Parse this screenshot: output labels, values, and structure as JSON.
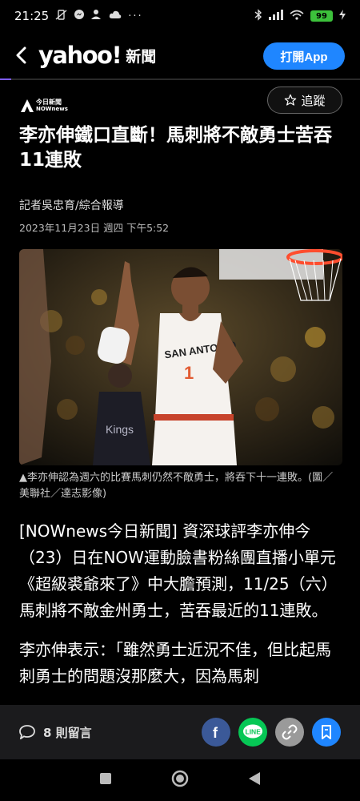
{
  "status_bar": {
    "time": "21:25",
    "battery": "99"
  },
  "header": {
    "logo": "yahoo!",
    "logo_suffix": "新聞",
    "open_app_label": "打開App",
    "read_progress": 0.03
  },
  "source": {
    "line1": "今日新聞",
    "line2": "NOWnews",
    "follow_label": "追蹤"
  },
  "article": {
    "headline": "李亦伸鐵口直斷！馬刺將不敵勇士苦吞11連敗",
    "byline": "記者吳忠育/綜合報導",
    "date": "2023年11月23日 週四 下午5:52",
    "photo_jersey_text": "SAN ANTONIO",
    "photo_jersey_number": "1",
    "caption": "▲李亦伸認為週六的比賽馬刺仍然不敵勇士，將吞下十一連敗。(圖／美聯社／達志影像)",
    "paragraph1": "[NOWnews今日新聞] 資深球評李亦伸今（23）日在NOW運動臉書粉絲團直播小單元《超級裘爺來了》中大膽預測，11/25（六）馬刺將不敵金州勇士，苦吞最近的11連敗。",
    "paragraph2": "李亦伸表示：「雖然勇士近況不佳，但比起馬刺勇士的問題沒那麼大，因為馬刺"
  },
  "action_bar": {
    "comments_label": "8 則留言",
    "share_icons": [
      "facebook-icon",
      "line-icon",
      "link-icon",
      "bookmark-icon"
    ],
    "colors": {
      "facebook": "#3b5998",
      "line": "#06c755",
      "link": "#9a9a9a",
      "bookmark": "#1f86ff"
    }
  },
  "colors": {
    "accent": "#1f86ff",
    "progress": "#7d5cff",
    "background": "#000000"
  }
}
